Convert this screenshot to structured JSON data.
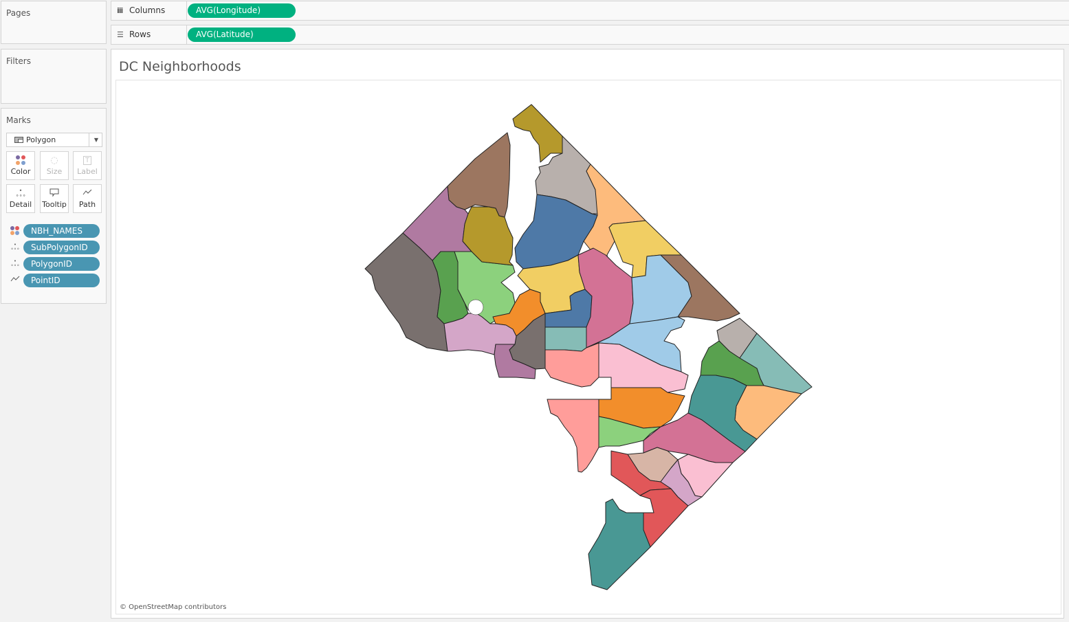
{
  "cards": {
    "pages_title": "Pages",
    "filters_title": "Filters",
    "marks_title": "Marks"
  },
  "shelves": {
    "columns": {
      "label": "Columns",
      "icon": "columns-icon",
      "pill": "AVG(Longitude)"
    },
    "rows": {
      "label": "Rows",
      "icon": "rows-icon",
      "pill": "AVG(Latitude)"
    }
  },
  "marks": {
    "mark_type": "Polygon",
    "buttons": [
      {
        "label": "Color",
        "icon": "color-icon",
        "enabled": true
      },
      {
        "label": "Size",
        "icon": "size-icon",
        "enabled": false
      },
      {
        "label": "Label",
        "icon": "label-icon",
        "enabled": false
      },
      {
        "label": "Detail",
        "icon": "detail-icon",
        "enabled": true
      },
      {
        "label": "Tooltip",
        "icon": "tooltip-icon",
        "enabled": true
      },
      {
        "label": "Path",
        "icon": "path-icon",
        "enabled": true
      }
    ],
    "fields": [
      {
        "name": "NBH_NAMES",
        "encoding": "color"
      },
      {
        "name": "SubPolygonID",
        "encoding": "detail"
      },
      {
        "name": "PolygonID",
        "encoding": "detail"
      },
      {
        "name": "PointID",
        "encoding": "path"
      }
    ]
  },
  "view": {
    "title": "DC Neighborhoods",
    "attribution": "© OpenStreetMap contributors"
  },
  "colors": {
    "pill_green": "#00b180",
    "pill_blue": "#4996b2"
  },
  "map": {
    "type": "polygon-map",
    "region": "Washington, DC",
    "polygon_count_visible": 39,
    "fills": [
      "#b5992c",
      "#9c7660",
      "#b8b0ac",
      "#fdbb7c",
      "#b07aa1",
      "#4e79a7",
      "#f1ce63",
      "#79706e",
      "#59a14f",
      "#8cd17d",
      "#d4a6c8",
      "#f28e2b",
      "#86bcb6",
      "#d37295",
      "#a0cbe8",
      "#ff9d9a",
      "#fabfd2",
      "#499894",
      "#e15759",
      "#d7b5a6"
    ]
  }
}
